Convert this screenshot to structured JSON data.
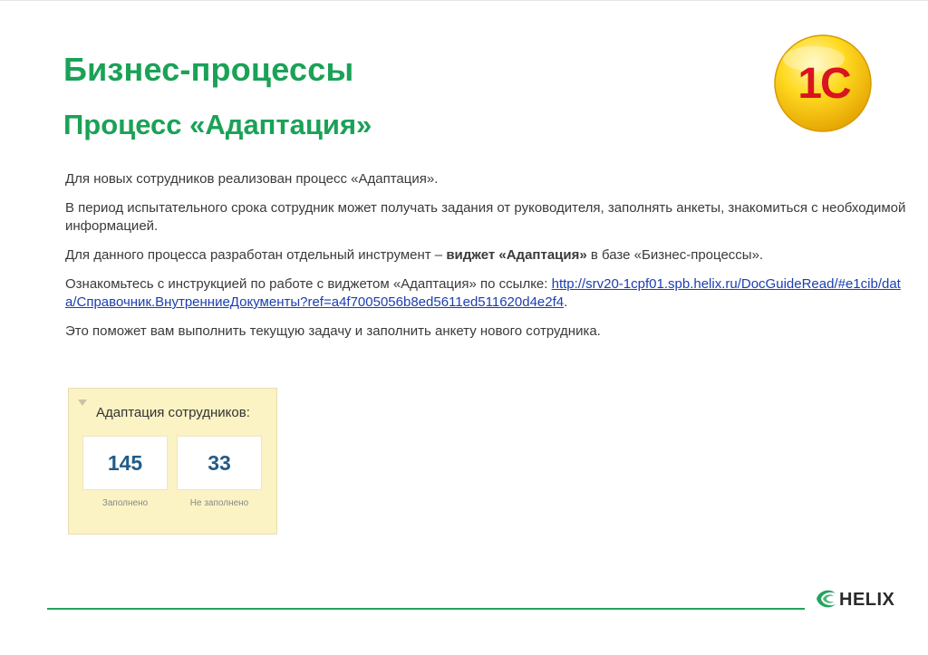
{
  "slide": {
    "title": "Бизнес-процессы",
    "subtitle": "Процесс «Адаптация»",
    "logo_text": "1С",
    "paragraphs": {
      "p1": "Для новых сотрудников реализован процесс «Адаптация».",
      "p2": "В период испытательного срока сотрудник может получать задания от руководителя, заполнять анкеты, знакомиться с необходимой информацией.",
      "p3_before": "Для данного процесса разработан отдельный инструмент – ",
      "p3_bold": "виджет «Адаптация»",
      "p3_after": " в базе «Бизнес-процессы».",
      "p4_before": "Ознакомьтесь с инструкцией по работе с виджетом «Адаптация» по ссылке: ",
      "p4_link": "http://srv20-1cpf01.spb.helix.ru/DocGuideRead/#e1cib/data/Справочник.ВнутренниеДокументы?ref=a4f7005056b8ed5611ed511620d4e2f4",
      "p4_after": ".",
      "p5": "Это поможет вам выполнить текущую задачу и заполнить анкету нового сотрудника."
    },
    "widget": {
      "title": "Адаптация сотрудников:",
      "filled_value": "145",
      "filled_label": "Заполнено",
      "not_filled_value": "33",
      "not_filled_label": "Не заполнено"
    },
    "footer": {
      "brand": "HELIX"
    },
    "colors": {
      "accent": "#1aa257",
      "link": "#1a3fb0",
      "widget_bg": "#fbf3c4",
      "stat_value": "#215c88"
    }
  }
}
